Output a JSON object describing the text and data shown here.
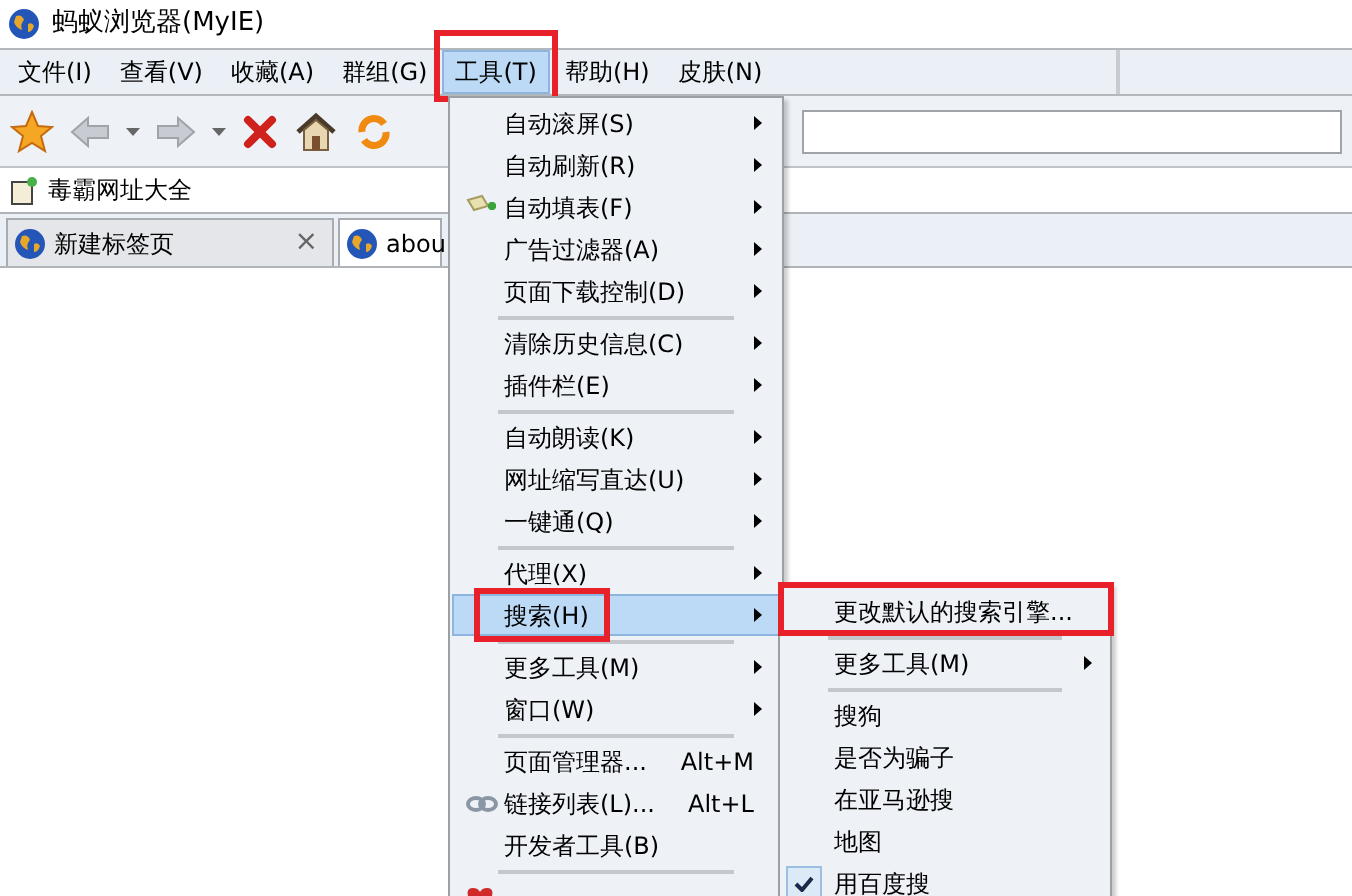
{
  "window": {
    "title": "蚂蚁浏览器(MyIE)"
  },
  "menu_bar": [
    {
      "label": "文件(I)",
      "selected": false,
      "annotated": false
    },
    {
      "label": "查看(V)",
      "selected": false,
      "annotated": false
    },
    {
      "label": "收藏(A)",
      "selected": false,
      "annotated": false
    },
    {
      "label": "群组(G)",
      "selected": false,
      "annotated": false
    },
    {
      "label": "工具(T)",
      "selected": true,
      "annotated": true
    },
    {
      "label": "帮助(H)",
      "selected": false,
      "annotated": false
    },
    {
      "label": "皮肤(N)",
      "selected": false,
      "annotated": false
    }
  ],
  "bookmarks": [
    {
      "label": "毒霸网址大全"
    }
  ],
  "tabs": [
    {
      "label": "新建标签页",
      "selected": false,
      "close": "×"
    },
    {
      "label": "abou",
      "selected": true
    }
  ],
  "tools_menu": [
    [
      {
        "label": "自动滚屏(S)",
        "submenu": true,
        "selected": false,
        "annotated": false
      },
      {
        "label": "自动刷新(R)",
        "submenu": true,
        "selected": false,
        "annotated": false
      },
      {
        "label": "自动填表(F)",
        "submenu": true,
        "selected": false,
        "annotated": false
      },
      {
        "label": "广告过滤器(A)",
        "submenu": true,
        "selected": false,
        "annotated": false
      },
      {
        "label": "页面下载控制(D)",
        "submenu": true,
        "selected": false,
        "annotated": false
      }
    ],
    [
      {
        "label": "清除历史信息(C)",
        "submenu": true,
        "selected": false,
        "annotated": false
      },
      {
        "label": "插件栏(E)",
        "submenu": true,
        "selected": false,
        "annotated": false
      }
    ],
    [
      {
        "label": "自动朗读(K)",
        "submenu": true,
        "selected": false,
        "annotated": false
      },
      {
        "label": "网址缩写直达(U)",
        "submenu": true,
        "selected": false,
        "annotated": false
      },
      {
        "label": "一键通(Q)",
        "submenu": true,
        "selected": false,
        "annotated": false
      }
    ],
    [
      {
        "label": "代理(X)",
        "submenu": true,
        "selected": false,
        "annotated": false
      },
      {
        "label": "搜索(H)",
        "submenu": true,
        "selected": true,
        "annotated": true
      }
    ],
    [
      {
        "label": "更多工具(M)",
        "submenu": true,
        "selected": false,
        "annotated": false
      },
      {
        "label": "窗口(W)",
        "submenu": true,
        "selected": false,
        "annotated": false
      }
    ],
    [
      {
        "label": "页面管理器...",
        "shortcut": "Alt+M",
        "submenu": false,
        "selected": false,
        "annotated": false
      },
      {
        "label": "链接列表(L)...",
        "shortcut": "Alt+L",
        "submenu": false,
        "selected": false,
        "annotated": false
      },
      {
        "label": "开发者工具(B)",
        "submenu": false,
        "selected": false,
        "annotated": false
      }
    ]
  ],
  "search_submenu": [
    [
      {
        "label": "更改默认的搜索引擎...",
        "submenu": false,
        "checked": false,
        "annotated": true
      }
    ],
    [
      {
        "label": "更多工具(M)",
        "submenu": true,
        "checked": false,
        "annotated": false
      }
    ],
    [
      {
        "label": "搜狗",
        "submenu": false,
        "checked": false,
        "annotated": false
      },
      {
        "label": "是否为骗子",
        "submenu": false,
        "checked": false,
        "annotated": false
      },
      {
        "label": "在亚马逊搜",
        "submenu": false,
        "checked": false,
        "annotated": false
      },
      {
        "label": "地图",
        "submenu": false,
        "checked": false,
        "annotated": false
      },
      {
        "label": "用百度搜",
        "submenu": false,
        "checked": true,
        "annotated": false
      }
    ]
  ]
}
